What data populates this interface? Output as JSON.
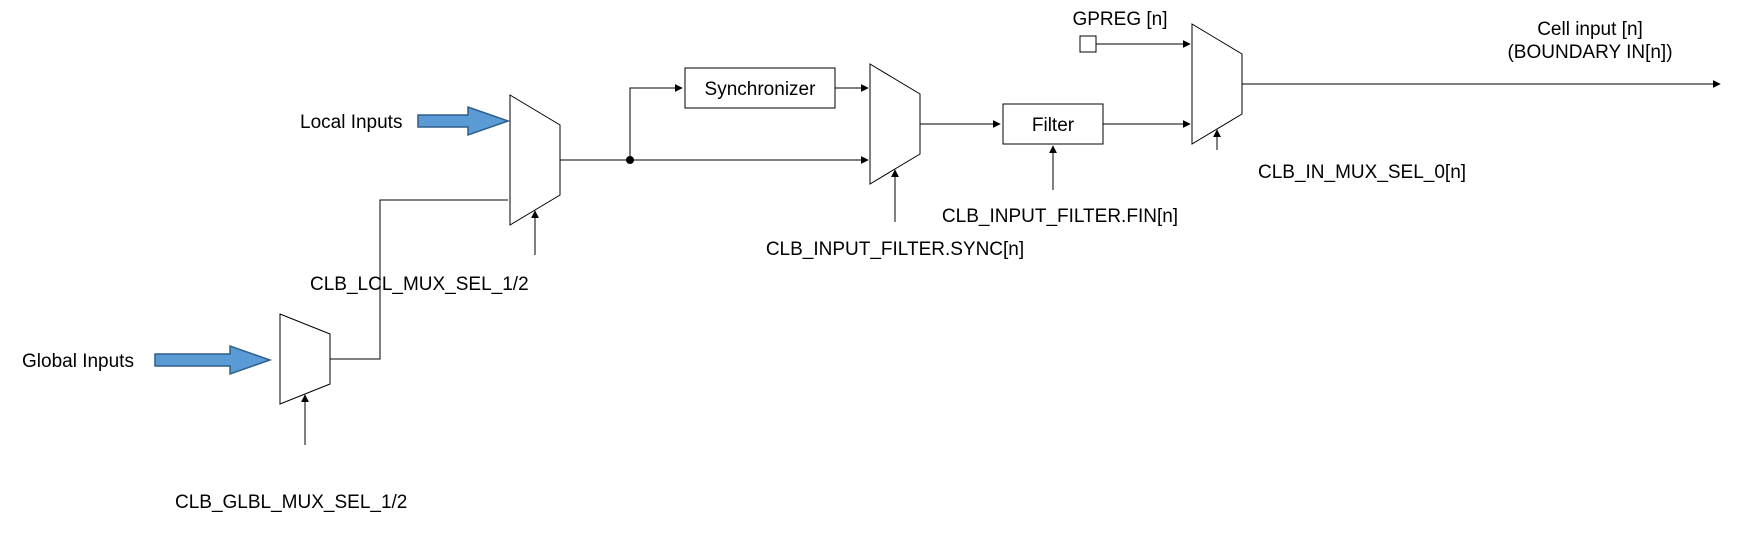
{
  "labels": {
    "globalInputs": "Global Inputs",
    "localInputs": "Local Inputs",
    "glblMuxSel": "CLB_GLBL_MUX_SEL_1/2",
    "lclMuxSel": "CLB_LCL_MUX_SEL_1/2",
    "synchronizer": "Synchronizer",
    "filter": "Filter",
    "inputFilterSync": "CLB_INPUT_FILTER.SYNC[n]",
    "inputFilterFin": "CLB_INPUT_FILTER.FIN[n]",
    "gpreg": "GPREG [n]",
    "inMuxSel0": "CLB_IN_MUX_SEL_0[n]",
    "cellInput1": "Cell input [n]",
    "cellInput2": "(BOUNDARY IN[n])"
  },
  "chart_data": {
    "type": "diagram",
    "title": "CLB input signal path",
    "nodes": [
      {
        "id": "globalInputsSrc",
        "type": "source",
        "label": "Global Inputs"
      },
      {
        "id": "localInputsSrc",
        "type": "source",
        "label": "Local Inputs"
      },
      {
        "id": "glblMux",
        "type": "mux",
        "select": "CLB_GLBL_MUX_SEL_1/2"
      },
      {
        "id": "lclMux",
        "type": "mux",
        "select": "CLB_LCL_MUX_SEL_1/2"
      },
      {
        "id": "sync",
        "type": "block",
        "label": "Synchronizer"
      },
      {
        "id": "syncMux",
        "type": "mux",
        "select": "CLB_INPUT_FILTER.SYNC[n]"
      },
      {
        "id": "filter",
        "type": "block",
        "label": "Filter",
        "control": "CLB_INPUT_FILTER.FIN[n]"
      },
      {
        "id": "gpreg",
        "type": "register",
        "label": "GPREG [n]"
      },
      {
        "id": "outMux",
        "type": "mux",
        "select": "CLB_IN_MUX_SEL_0[n]"
      },
      {
        "id": "cellInput",
        "type": "sink",
        "label": "Cell input [n] (BOUNDARY IN[n])"
      }
    ],
    "edges": [
      {
        "from": "globalInputsSrc",
        "to": "glblMux"
      },
      {
        "from": "glblMux",
        "to": "lclMux",
        "port": "lower"
      },
      {
        "from": "localInputsSrc",
        "to": "lclMux",
        "port": "upper"
      },
      {
        "from": "lclMux",
        "to": "sync",
        "branch": true
      },
      {
        "from": "lclMux",
        "to": "syncMux",
        "port": "lower",
        "branch": true
      },
      {
        "from": "sync",
        "to": "syncMux",
        "port": "upper"
      },
      {
        "from": "syncMux",
        "to": "filter"
      },
      {
        "from": "filter",
        "to": "outMux",
        "port": "lower"
      },
      {
        "from": "gpreg",
        "to": "outMux",
        "port": "upper"
      },
      {
        "from": "outMux",
        "to": "cellInput"
      }
    ]
  }
}
